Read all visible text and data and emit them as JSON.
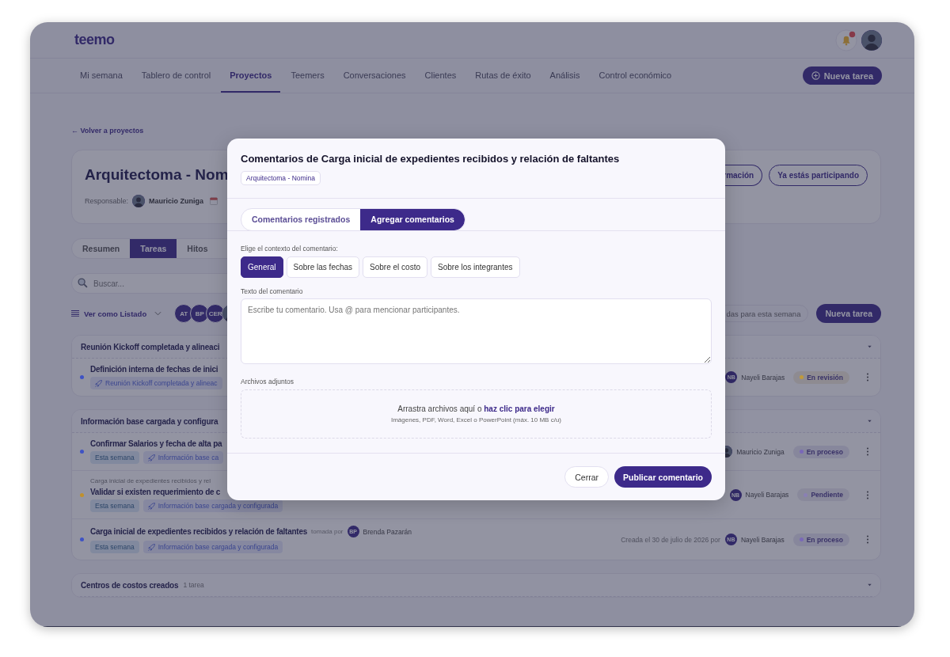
{
  "header": {
    "logo": "teemo"
  },
  "nav": [
    {
      "label": "Mi semana",
      "selected": false
    },
    {
      "label": "Tablero de control",
      "selected": false
    },
    {
      "label": "Proyectos",
      "selected": true
    },
    {
      "label": "Teemers",
      "selected": false
    },
    {
      "label": "Conversaciones",
      "selected": false
    },
    {
      "label": "Clientes",
      "selected": false
    },
    {
      "label": "Rutas de éxito",
      "selected": false
    },
    {
      "label": "Análisis",
      "selected": false
    },
    {
      "label": "Control económico",
      "selected": false
    }
  ],
  "new_task_button": "Nueva tarea",
  "back_link": "← Volver a proyectos",
  "project": {
    "title": "Arquitectoma - Nom",
    "responsible_label": "Responsable:",
    "responsible": "Mauricio Zuniga",
    "actions": [
      "rmación",
      "Ya estás participando"
    ]
  },
  "tabs": [
    {
      "label": "Resumen",
      "selected": false
    },
    {
      "label": "Tareas",
      "selected": true
    },
    {
      "label": "Hitos",
      "selected": false
    }
  ],
  "search": {
    "placeholder": "Buscar..."
  },
  "view_toggle": "Ver como Listado",
  "members": [
    {
      "kind": "initials",
      "initials": "AT"
    },
    {
      "kind": "initials",
      "initials": "BP"
    },
    {
      "kind": "initials",
      "initials": "CER"
    },
    {
      "kind": "photo"
    }
  ],
  "filter_chip": "das para esta semana",
  "list_new_task_button": "Nueva tarea",
  "groups": [
    {
      "title": "Reunión Kickoff completada y alineaci",
      "tasks": [
        {
          "title": "Definición interna de fechas de inici",
          "color": "#3e52c4",
          "tags": [
            {
              "kind": "milestone",
              "label": "Reunión Kickoff completada y alineac"
            }
          ],
          "assignee": {
            "kind": "initials",
            "initials": "NB",
            "name": "Nayeli Barajas"
          },
          "status": {
            "label": "En revisión",
            "color": "#c09a3c"
          }
        }
      ]
    },
    {
      "title": "Información base cargada y configura",
      "tasks": [
        {
          "title": "Confirmar Salarios y fecha de alta pa",
          "color": "#3e52c4",
          "tags": [
            {
              "kind": "week",
              "label": "Esta semana"
            },
            {
              "kind": "milestone",
              "label": "Información base ca"
            }
          ],
          "assignee": {
            "kind": "photo",
            "name": "Mauricio Zuniga"
          },
          "status": {
            "label": "En proceso",
            "color": "#7a68b8"
          }
        },
        {
          "parent": "Carga inicial de expedientes recibidos y rel",
          "title": "Validar si existen requerimiento de c",
          "color": "#c0902c",
          "tags": [
            {
              "kind": "week",
              "label": "Esta semana"
            },
            {
              "kind": "milestone",
              "label": "Información base cargada y configurada"
            }
          ],
          "assignee": {
            "kind": "initials",
            "initials": "NB",
            "name": "Nayeli Barajas"
          },
          "status": {
            "label": "Pendiente",
            "color": "#8a80b4"
          }
        },
        {
          "title": "Carga inicial de expedientes recibidos y relación de faltantes",
          "taken_by": {
            "label": "tomada por",
            "initials": "BP",
            "name": "Brenda Pazarán"
          },
          "color": "#3e52c4",
          "tags": [
            {
              "kind": "week",
              "label": "Esta semana"
            },
            {
              "kind": "milestone",
              "label": "Información base cargada y configurada"
            }
          ],
          "created": "Creada el 30 de julio de 2026 por",
          "assignee": {
            "kind": "initials",
            "initials": "NB",
            "name": "Nayeli Barajas"
          },
          "status": {
            "label": "En proceso",
            "color": "#7a68b8"
          }
        }
      ]
    },
    {
      "title": "Centros de costos creados",
      "count": "1 tarea"
    }
  ],
  "modal": {
    "title": "Comentarios de Carga inicial de expedientes recibidos y relación de faltantes",
    "project_chip": "Arquitectoma - Nomina",
    "tabs": [
      {
        "label": "Comentarios registrados",
        "selected": false
      },
      {
        "label": "Agregar comentarios",
        "selected": true
      }
    ],
    "context_label": "Elige el contexto del comentario:",
    "contexts": [
      {
        "label": "General",
        "selected": true
      },
      {
        "label": "Sobre las fechas",
        "selected": false
      },
      {
        "label": "Sobre el costo",
        "selected": false
      },
      {
        "label": "Sobre los integrantes",
        "selected": false
      }
    ],
    "comment_label": "Texto del comentario",
    "comment_placeholder": "Escribe tu comentario. Usa @ para mencionar participantes.",
    "attachments_label": "Archivos adjuntos",
    "drop_text": "Arrastra archivos aquí o",
    "drop_link": "haz clic para elegir",
    "drop_hint": "Imágenes, PDF, Word, Excel o PowerPoint (máx. 10 MB c/u)",
    "cancel_button": "Cerrar",
    "submit_button": "Publicar comentario"
  }
}
